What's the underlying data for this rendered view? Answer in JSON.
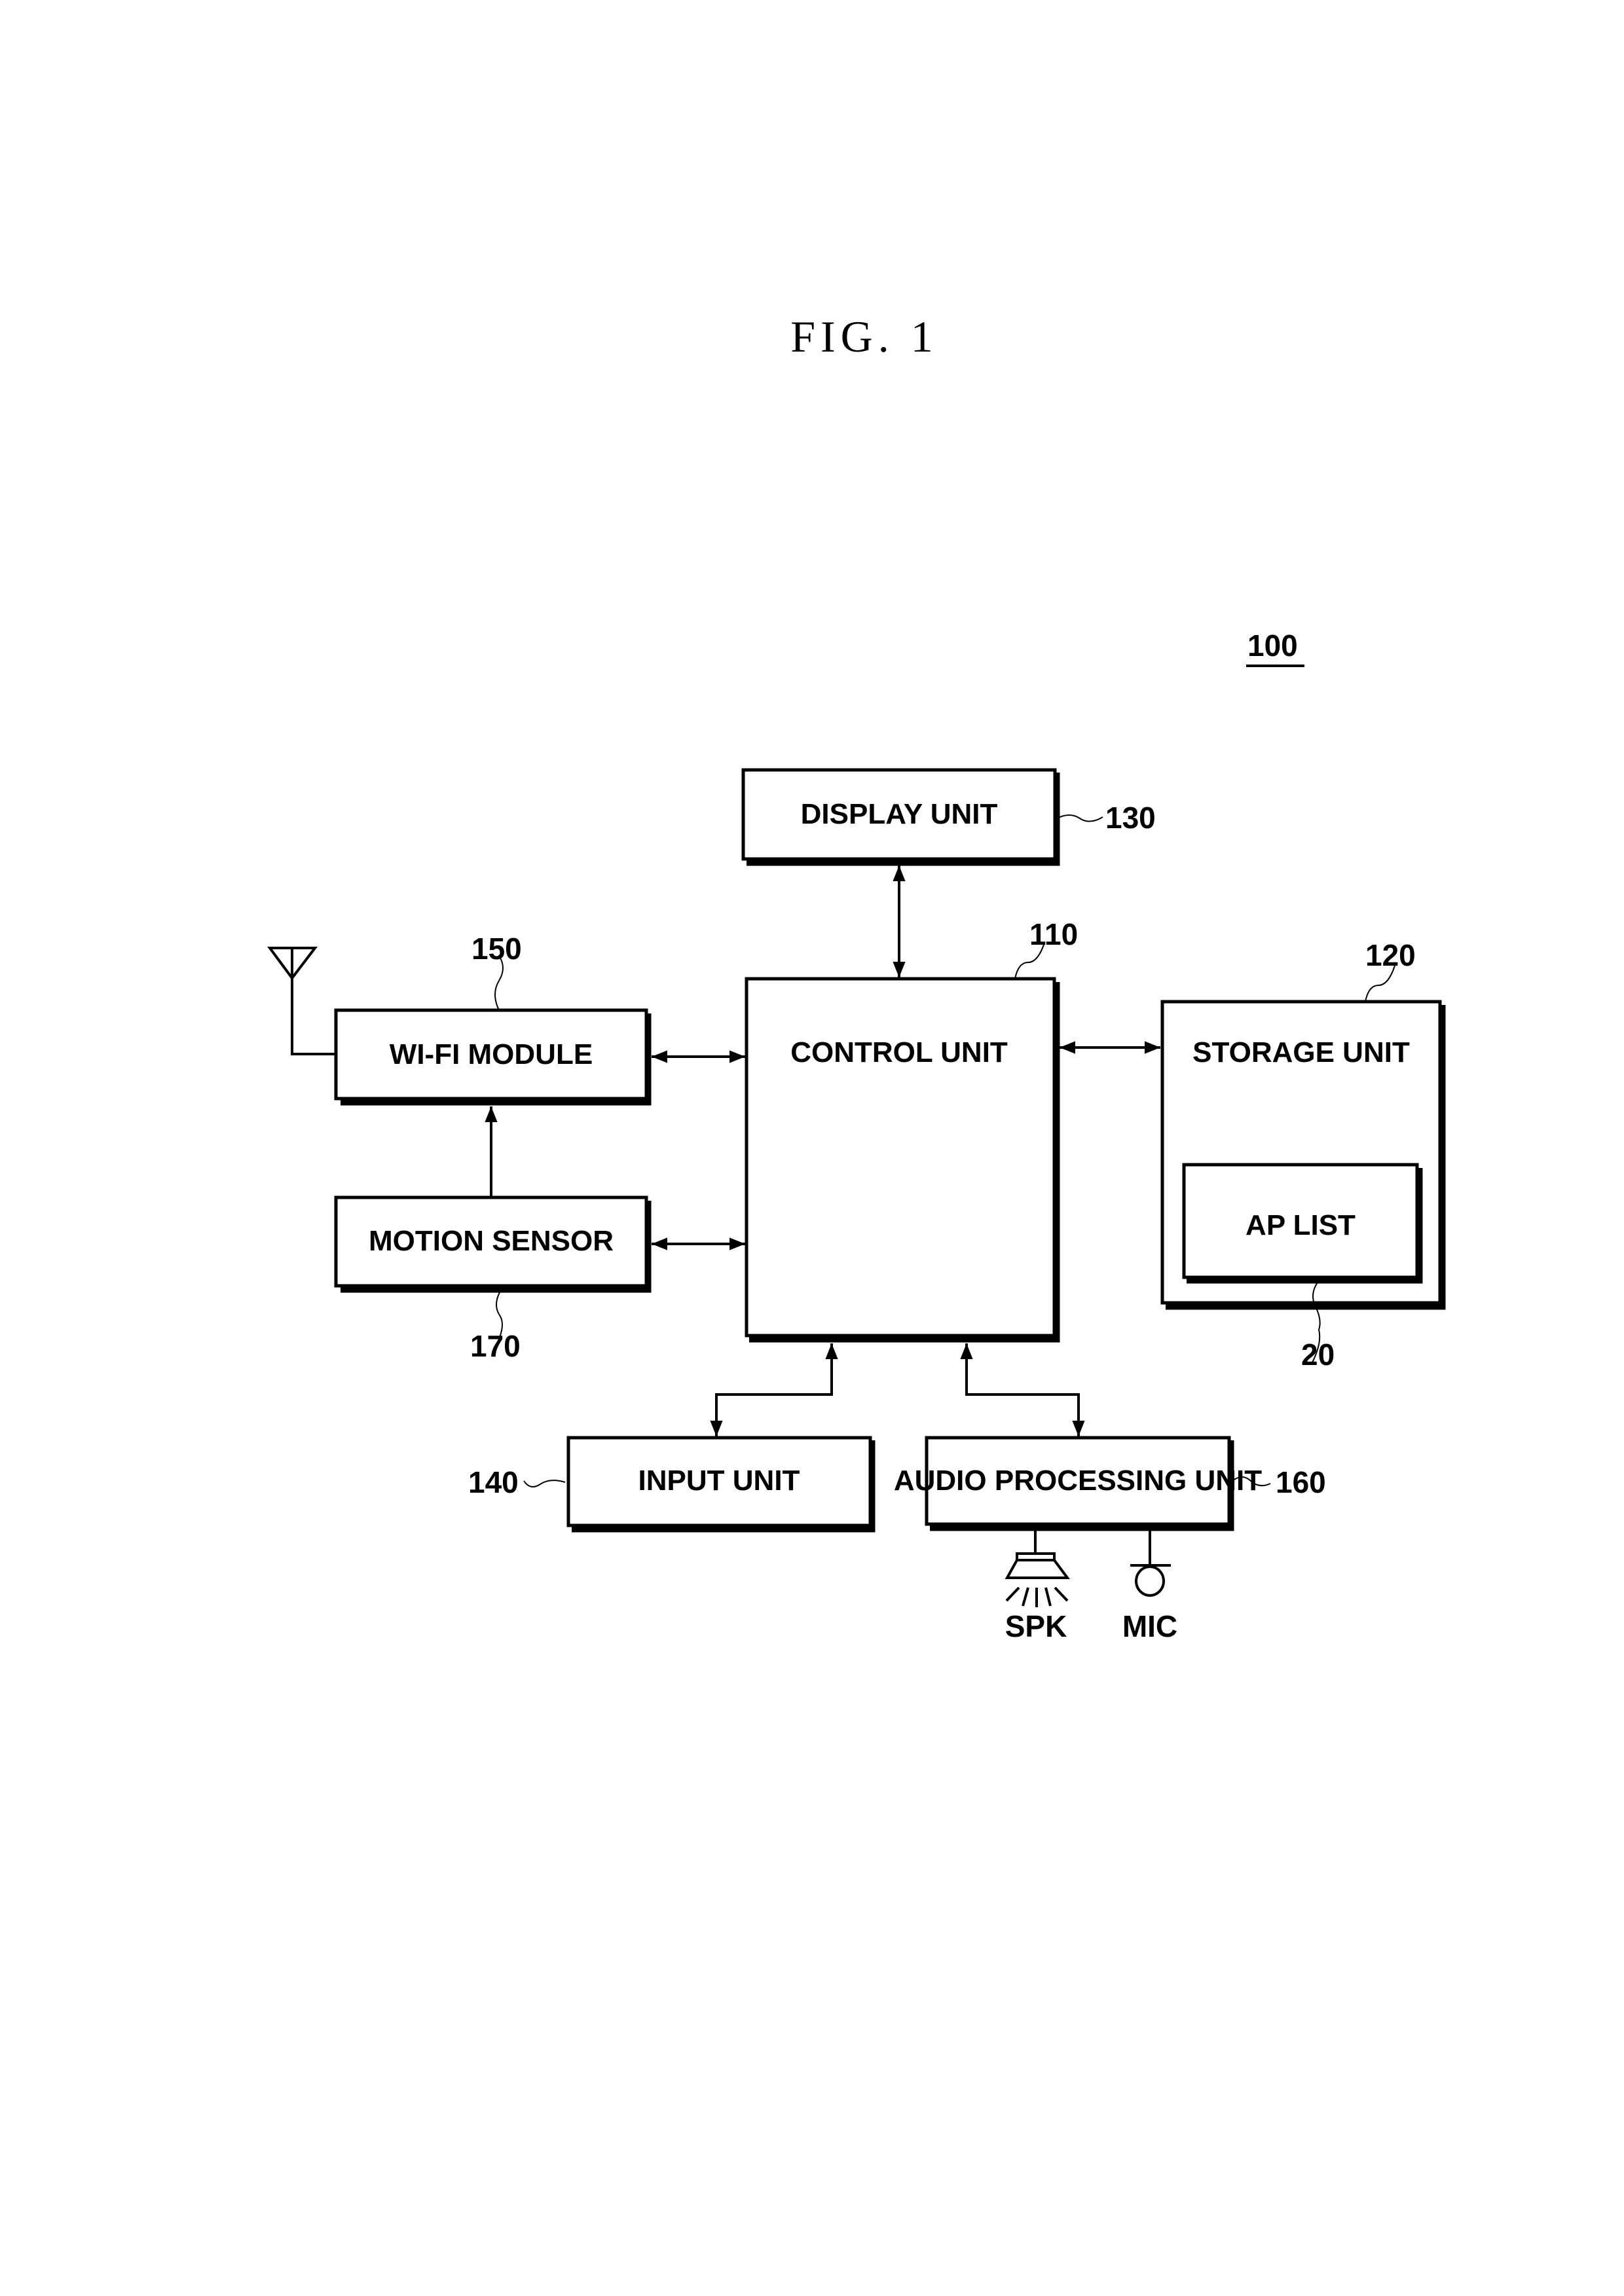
{
  "figure": {
    "title": "FIG. 1",
    "device_ref": "100"
  },
  "blocks": {
    "display": {
      "label": "DISPLAY UNIT",
      "ref": "130"
    },
    "control": {
      "label": "CONTROL UNIT",
      "ref": "110"
    },
    "wifi": {
      "label": "WI-FI MODULE",
      "ref": "150"
    },
    "motion": {
      "label": "MOTION SENSOR",
      "ref": "170"
    },
    "storage": {
      "label": "STORAGE UNIT",
      "ref": "120"
    },
    "aplist": {
      "label": "AP LIST",
      "ref": "20"
    },
    "input": {
      "label": "INPUT UNIT",
      "ref": "140"
    },
    "audio": {
      "label": "AUDIO PROCESSING UNIT",
      "ref": "160"
    }
  },
  "peripherals": {
    "speaker": {
      "label": "SPK",
      "icon": "speaker-icon"
    },
    "mic": {
      "label": "MIC",
      "icon": "microphone-icon"
    },
    "antenna": {
      "icon": "antenna-icon"
    }
  }
}
